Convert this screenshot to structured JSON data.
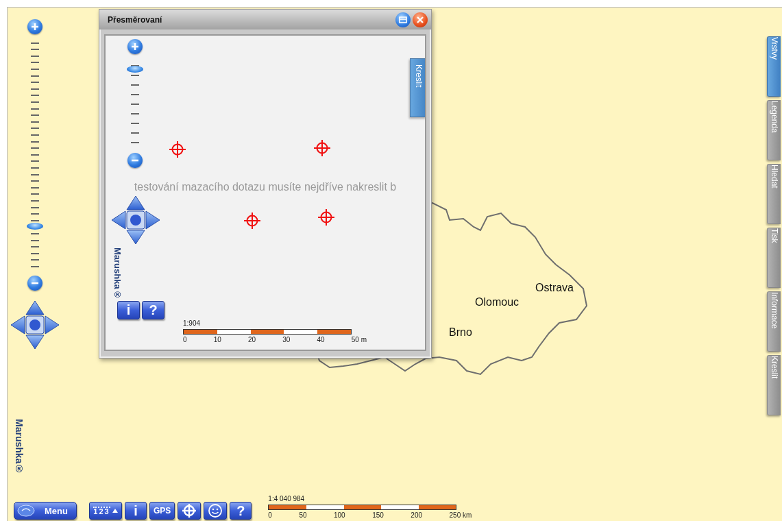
{
  "map": {
    "zoom_slider": {
      "level": 0.19
    },
    "cities": [
      {
        "name": "Ostrava"
      },
      {
        "name": "Olomouc"
      },
      {
        "name": "Brno"
      }
    ],
    "logo": "Marushka®",
    "side_tabs": [
      {
        "label": "Vrstvy",
        "selected": true
      },
      {
        "label": "Legenda",
        "selected": false
      },
      {
        "label": "Hledat",
        "selected": false
      },
      {
        "label": "Tisk",
        "selected": false
      },
      {
        "label": "Informace",
        "selected": false
      },
      {
        "label": "Kreslit",
        "selected": false
      }
    ],
    "menu_button": "Menu",
    "toolbar": [
      {
        "kind": "ruler",
        "label": "123"
      },
      {
        "kind": "text",
        "label": "i"
      },
      {
        "kind": "text",
        "label": "GPS"
      },
      {
        "kind": "target"
      },
      {
        "kind": "smiley"
      },
      {
        "kind": "text",
        "label": "?"
      }
    ],
    "scale": {
      "ratio": "1:4 040 984",
      "ticks": [
        "0",
        "50",
        "100",
        "150",
        "200",
        "250 km"
      ]
    }
  },
  "popup": {
    "title": "Přesměrovaní",
    "zoom_slider": {
      "level": 0.9
    },
    "drawing_tab": "Kreslit",
    "message": "testování mazacího dotazu musíte nejdříve nakreslit b",
    "logo": "Marushka®",
    "buttons": [
      {
        "kind": "text",
        "label": "i"
      },
      {
        "kind": "text",
        "label": "?"
      }
    ],
    "scale": {
      "ratio": "1:904",
      "ticks": [
        "0",
        "10",
        "20",
        "30",
        "40",
        "50 m"
      ]
    }
  }
}
